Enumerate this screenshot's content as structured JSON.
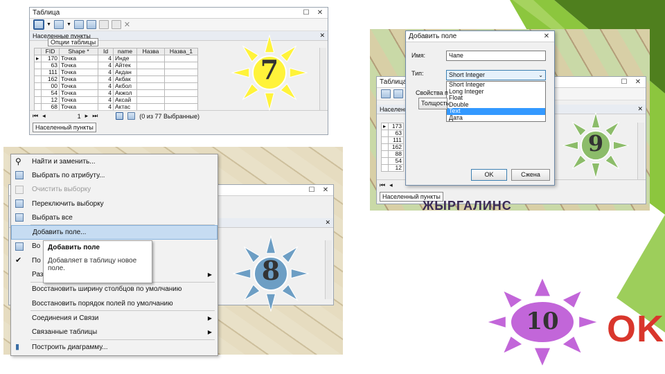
{
  "colors": {
    "accent_green": "#8cc63e",
    "dark_green": "#4f7f1e",
    "sun_yellow": "#fff33a",
    "sun_blue": "#6d9ec4",
    "sun_green": "#8cbc6a",
    "sun_purple": "#c266d9",
    "ok_red": "#d9362c"
  },
  "step_numbers": {
    "s7": "7",
    "s8": "8",
    "s9": "9",
    "s10": "10"
  },
  "ok_label": "OK",
  "panel7": {
    "title": "Таблица",
    "tab_label": "Населенные пункты",
    "tooltip": "Опции таблицы",
    "columns": [
      "FID",
      "Shape *",
      "Id",
      "name",
      "Назва",
      "Назва_1"
    ],
    "rows": [
      [
        "170",
        "Точка",
        "4",
        "Инде"
      ],
      [
        "63",
        "Точка",
        "4",
        "Айтек"
      ],
      [
        "111",
        "Точка",
        "4",
        "Акдан"
      ],
      [
        "162",
        "Точка",
        "4",
        "Акбак"
      ],
      [
        "00",
        "Точка",
        "4",
        "Акбол"
      ],
      [
        "54",
        "Точка",
        "4",
        "Акжол"
      ],
      [
        "12",
        "Точка",
        "4",
        "Аксай"
      ],
      [
        "68",
        "Точка",
        "4",
        "Актас"
      ]
    ],
    "nav_current": "1",
    "nav_status": "(0 из 77 Выбранные)",
    "bottom_tab": "Населенный пункты"
  },
  "panel8": {
    "menu_items": [
      {
        "label": "Найти и заменить...",
        "icon": "binoculars-icon"
      },
      {
        "label": "Выбрать по атрибуту...",
        "icon": "select-by-attribute-icon"
      },
      {
        "label": "Очистить выборку",
        "icon": "clear-selection-icon"
      },
      {
        "label": "Переключить выборку",
        "icon": "switch-selection-icon"
      },
      {
        "label": "Выбрать все",
        "icon": "select-all-icon"
      },
      {
        "label": "Добавить поле...",
        "icon": ""
      },
      {
        "label": "Во",
        "icon": "field-grid-icon"
      },
      {
        "label": "По",
        "icon": "checkmark-icon"
      },
      {
        "label": "Раз",
        "icon": ""
      },
      {
        "label": "Восстановить ширину столбцов по умолчанию",
        "icon": ""
      },
      {
        "label": "Восстановить порядок полей по умолчанию",
        "icon": ""
      },
      {
        "label": "Соединения и Связи",
        "icon": ""
      },
      {
        "label": "Связанные таблицы",
        "icon": ""
      },
      {
        "label": "Построить диаграмму...",
        "icon": "chart-icon"
      }
    ],
    "tooltip_title": "Добавить поле",
    "tooltip_body": "Добавляет в таблицу новое поле."
  },
  "panel9": {
    "dialog_title": "Добавить поле",
    "name_label": "Имя:",
    "name_value": "Чапе",
    "type_label": "Тип:",
    "type_value": "Short Integer",
    "type_options": [
      "Short Integer",
      "Long Integer",
      "Float",
      "Double",
      "Text",
      "Дата"
    ],
    "selected_option_index": 4,
    "properties_label": "Свойства п",
    "properties_button": "Толщость",
    "ok_button": "OK",
    "cancel_button": "Сжена",
    "bg_window_title": "Таблица",
    "bg_tab_label": "Населенн",
    "bg_rows": [
      "173",
      "63",
      "111",
      "162",
      "88",
      "54",
      "12"
    ],
    "bottom_tab": "Населенный пункты",
    "map_text": "ЖЫРГАЛИНС"
  }
}
